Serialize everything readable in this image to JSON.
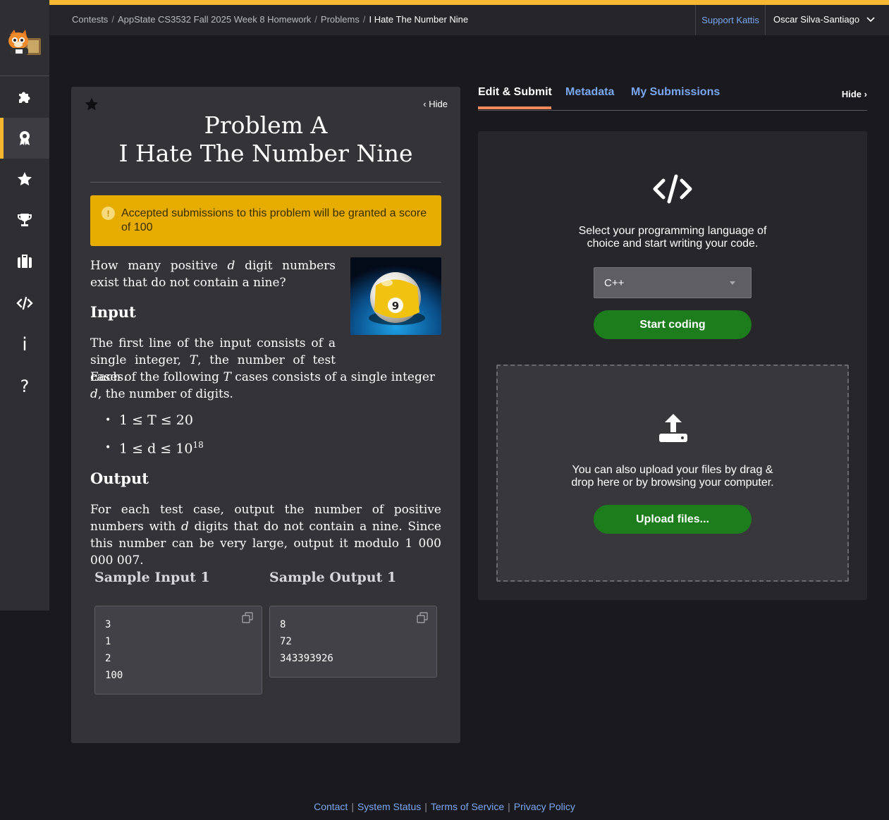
{
  "topbar": {
    "breadcrumb": [
      "Contests",
      "AppState CS3532 Fall 2025 Week 8 Homework",
      "Problems",
      "I Hate The Number Nine"
    ],
    "support_label": "Support Kattis",
    "user_name": "Oscar Silva-Santiago"
  },
  "sidebar": {
    "items": [
      "puzzle-icon",
      "badge-icon",
      "star-icon",
      "trophy-icon",
      "briefcase-icon",
      "code-icon",
      "info-icon",
      "help-icon"
    ],
    "active_index": 1,
    "info_glyph": "i",
    "help_glyph": "?"
  },
  "problem": {
    "hide_label": "Hide",
    "title_line1": "Problem A",
    "title_line2": "I Hate The Number Nine",
    "alert": "Accepted submissions to this problem will be granted a score of 100",
    "alert_glyph": "!",
    "intro_a": "How many positive",
    "intro_var": "d",
    "intro_b": "digit numbers exist that do not contain a nine?",
    "input_heading": "Input",
    "input_p1_a": "The first line of the input consists of a single integer,",
    "input_p1_var": "T",
    "input_p1_b": ", the number of test cases.",
    "input_p2_a": "Each of the following",
    "input_p2_var1": "T",
    "input_p2_b": "cases consists of a single integer",
    "input_p2_var2": "d",
    "input_p2_c": ", the number of digits.",
    "constraint1": "1 ≤ T ≤ 20",
    "constraint2_base": "1 ≤ d ≤ 10",
    "constraint2_exp": "18",
    "output_heading": "Output",
    "output_a": "For each test case, output the number of positive numbers with",
    "output_var": "d",
    "output_b": "digits that do not contain a nine. Since this number can be very large, output it modulo 1 000 000 007.",
    "sample_input_heading": "Sample Input 1",
    "sample_output_heading": "Sample Output 1",
    "sample_input": [
      "3",
      "1",
      "2",
      "100"
    ],
    "sample_output": [
      "8",
      "72",
      "343393926"
    ],
    "ball_number": "9"
  },
  "submit": {
    "tabs": [
      "Edit & Submit",
      "Metadata",
      "My Submissions"
    ],
    "active_tab": 0,
    "hide_label": "Hide",
    "prompt_line1": "Select your programming language of",
    "prompt_line2": "choice and start writing your code.",
    "language": "C++",
    "start_label": "Start coding",
    "drop_line1": "You can also upload your files by drag &",
    "drop_line2": "drop here or by browsing your computer.",
    "upload_label": "Upload files..."
  },
  "footer": {
    "links": [
      "Contact",
      "System Status",
      "Terms of Service",
      "Privacy Policy"
    ]
  },
  "colors": {
    "accent": "#f7b731",
    "link": "#7aa7f4",
    "green": "#1d7d1d",
    "alert": "#e6ac00",
    "tab_underline": "#f08a5d"
  }
}
